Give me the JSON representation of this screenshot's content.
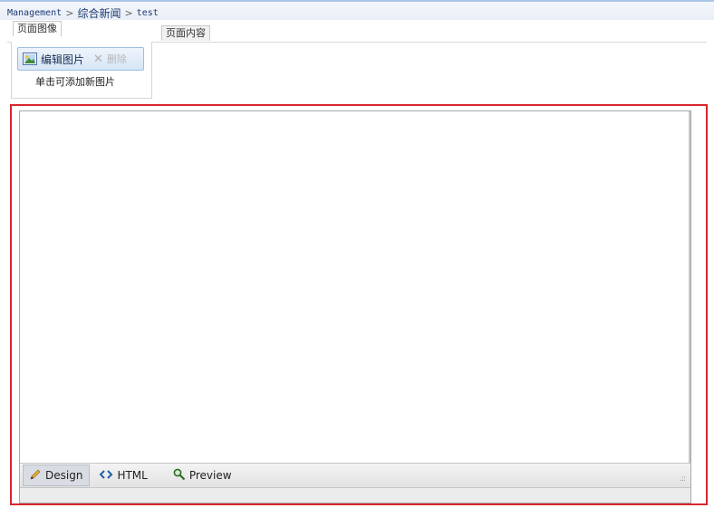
{
  "breadcrumb": {
    "item1": "Management",
    "separator": ">",
    "item2": "综合新闻",
    "item3": "test"
  },
  "tabs": {
    "page_image": "页面图像",
    "page_content": "页面内容"
  },
  "image_panel": {
    "edit_label": "编辑图片",
    "delete_label": "删除",
    "hint": "单击可添加新图片"
  },
  "editor": {
    "modes": {
      "design": "Design",
      "html": "HTML",
      "preview": "Preview"
    },
    "active_mode": "Design"
  },
  "icons": {
    "design": "pencil-icon",
    "html": "code-icon",
    "preview": "magnifier-icon",
    "edit_image": "picture-icon",
    "delete": "close-icon"
  },
  "colors": {
    "highlight_frame": "#d9262c",
    "toolbar_blue": "#9ebde0"
  }
}
